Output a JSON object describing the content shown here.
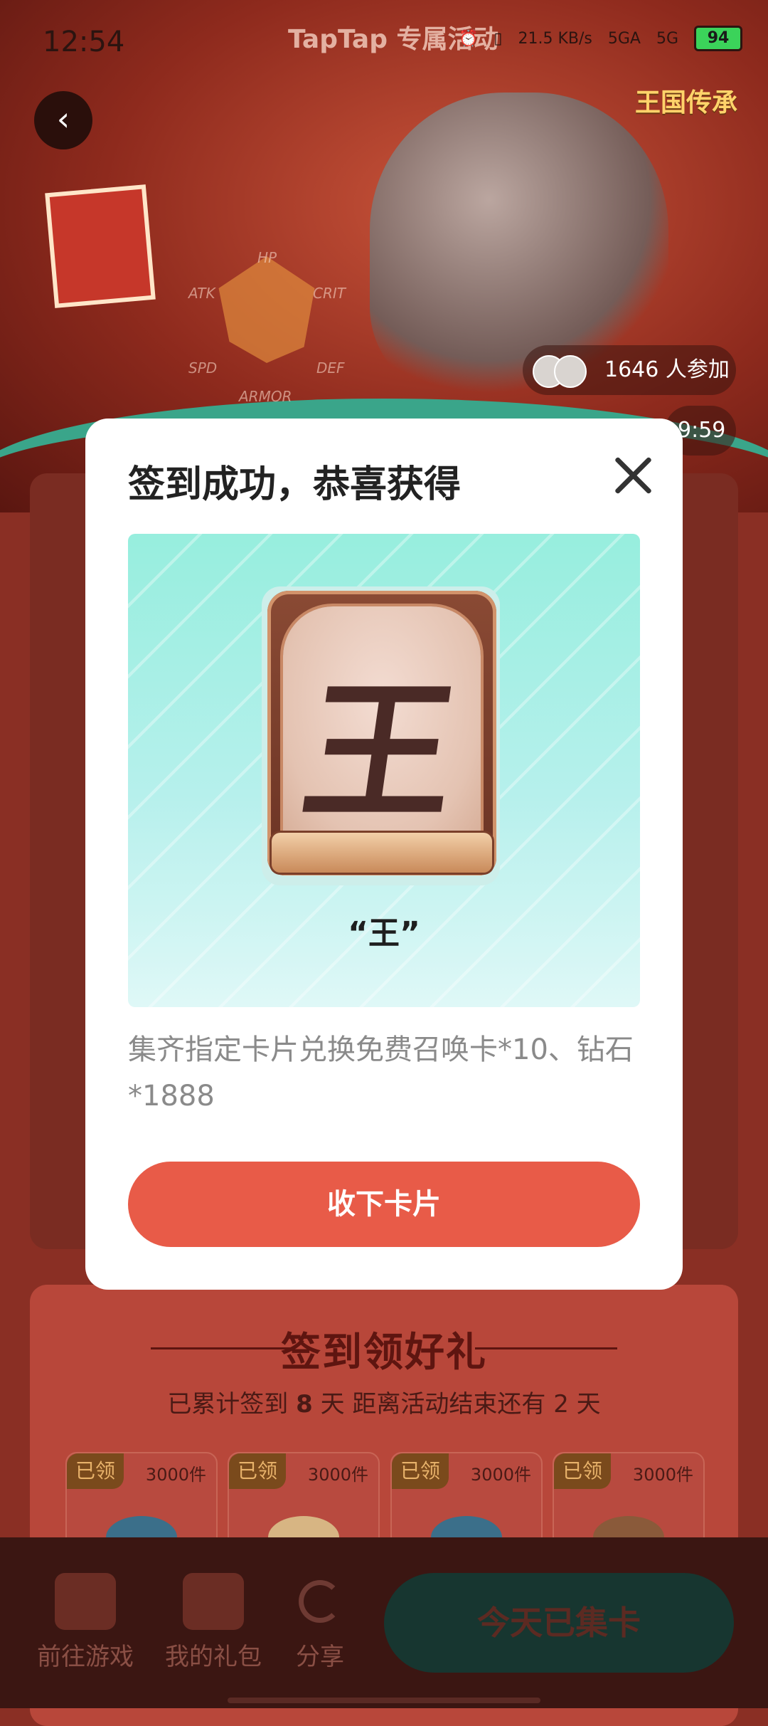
{
  "status_bar": {
    "time": "12:54",
    "header_text": "TapTap 专属活动",
    "net_speed": "21.5 KB/s",
    "signal_1": "5GA",
    "signal_2": "5G",
    "battery": "94"
  },
  "hero": {
    "game_logo": "王国传承",
    "stats": [
      "HP",
      "CRIT",
      "DEF",
      "ARMOR",
      "SPD",
      "ATK"
    ],
    "participants": "1646 人参加",
    "countdown_partial": "9:59"
  },
  "modal": {
    "title": "签到成功，恭喜获得",
    "card_character": "王",
    "card_name": "“王”",
    "description": "集齐指定卡片兑换免费召唤卡*10、钻石*1888",
    "accept_label": "收下卡片"
  },
  "signin": {
    "title": "签到领好礼",
    "sub_prefix": "已累计签到",
    "days": "8",
    "sub_middle": "天  距离活动结束还有 2 天",
    "rewards": [
      {
        "tag": "已领",
        "count": "3000件"
      },
      {
        "tag": "已领",
        "count": "3000件"
      },
      {
        "tag": "已领",
        "count": "3000件"
      },
      {
        "tag": "已领",
        "count": "3000件"
      }
    ]
  },
  "bottom_nav": {
    "goto_game": "前往游戏",
    "my_gifts": "我的礼包",
    "share": "分享",
    "collect_btn": "今天已集卡"
  },
  "colors": {
    "accent": "#e85b48",
    "modal_bg": "#ffffff",
    "card_bg": "#97eede"
  }
}
